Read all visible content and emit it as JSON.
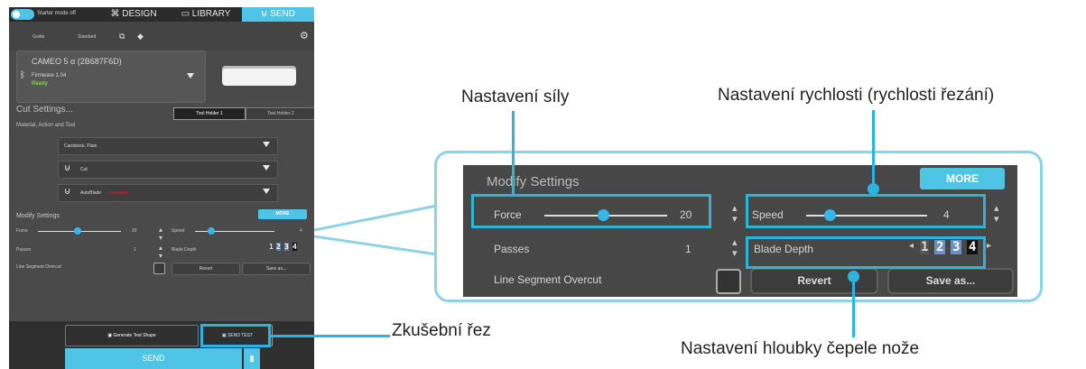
{
  "topbar": {
    "starter_mode": "Starter mode off",
    "tabs": [
      {
        "label": "DESIGN",
        "icon": "design-icon"
      },
      {
        "label": "LIBRARY",
        "icon": "folder-icon"
      },
      {
        "label": "SEND",
        "icon": "send-icon"
      }
    ]
  },
  "subbar": {
    "guide": "Guide",
    "standard": "Standard"
  },
  "device": {
    "name": "CAMEO 5 α (2B687F6D)",
    "firmware": "Firmware 1.04",
    "status": "Ready"
  },
  "cut_settings": {
    "title": "Cut Settings...",
    "tool_holder_1": "Tool Holder 1",
    "tool_holder_2": "Tool Holder 2",
    "material_label": "Material, Action and Tool",
    "material": "Cardstock, Plain",
    "action": "Cut",
    "tool": "AutoBlade",
    "tool_extra": "Detected"
  },
  "modify": {
    "title": "Modify Settings",
    "more": "MORE",
    "force_label": "Force",
    "force_value": "20",
    "force_level": 0.48,
    "speed_label": "Speed",
    "speed_value": "4",
    "speed_level": 0.2,
    "passes_label": "Passes",
    "passes_value": "1",
    "blade_label": "Blade Depth",
    "blade_digits": [
      "1",
      "2",
      "3",
      "4"
    ],
    "line_segment": "Line Segment Overcut",
    "revert": "Revert",
    "save_as": "Save as..."
  },
  "bottom": {
    "generate": "Generate Test Shape",
    "send_test": "SEND TEST",
    "send": "SEND"
  },
  "annotations": {
    "force": "Nastavení síly",
    "speed": "Nastavení rychlosti (rychlosti řezání)",
    "test": "Zkušební řez",
    "blade": "Nastavení hloubky čepele nože"
  },
  "colors": {
    "accent": "#4fc4e6",
    "highlight": "#29b5e0",
    "ready": "#7fd44a",
    "detected": "#e02020"
  }
}
